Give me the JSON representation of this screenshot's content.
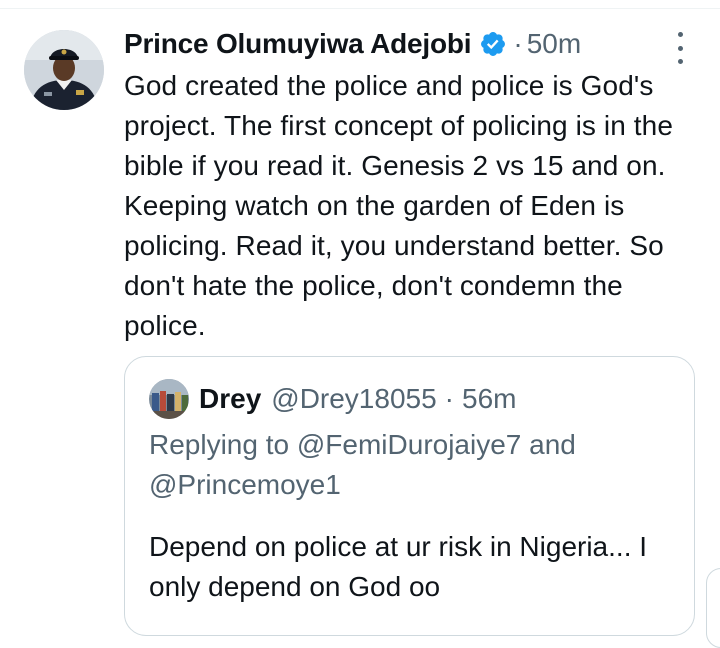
{
  "tweet": {
    "author_name": "Prince Olumuyiwa Adejobi",
    "verified_icon": "verified-badge-icon",
    "separator": "·",
    "time": "50m",
    "text": "God created the police and police is God's project. The first concept of policing is in the bible if you read it. Genesis 2 vs 15 and on. Keeping watch on the garden of Eden is policing. Read it, you understand better. So don't hate the police, don't condemn the police."
  },
  "quote": {
    "author_name": "Drey",
    "handle": "@Drey18055",
    "separator": "·",
    "time": "56m",
    "replying_prefix": "Replying to",
    "replying_mention_1": "@FemiDurojaiye7",
    "replying_and": "and",
    "replying_mention_2": "@Princemoye1",
    "text": "Depend on police at ur risk in Nigeria... I only depend on God oo"
  },
  "colors": {
    "text": "#0f1419",
    "secondary": "#536471",
    "verified": "#1d9bf0",
    "border": "#cfd9de"
  },
  "icons": {
    "more": "more-vertical-icon"
  }
}
